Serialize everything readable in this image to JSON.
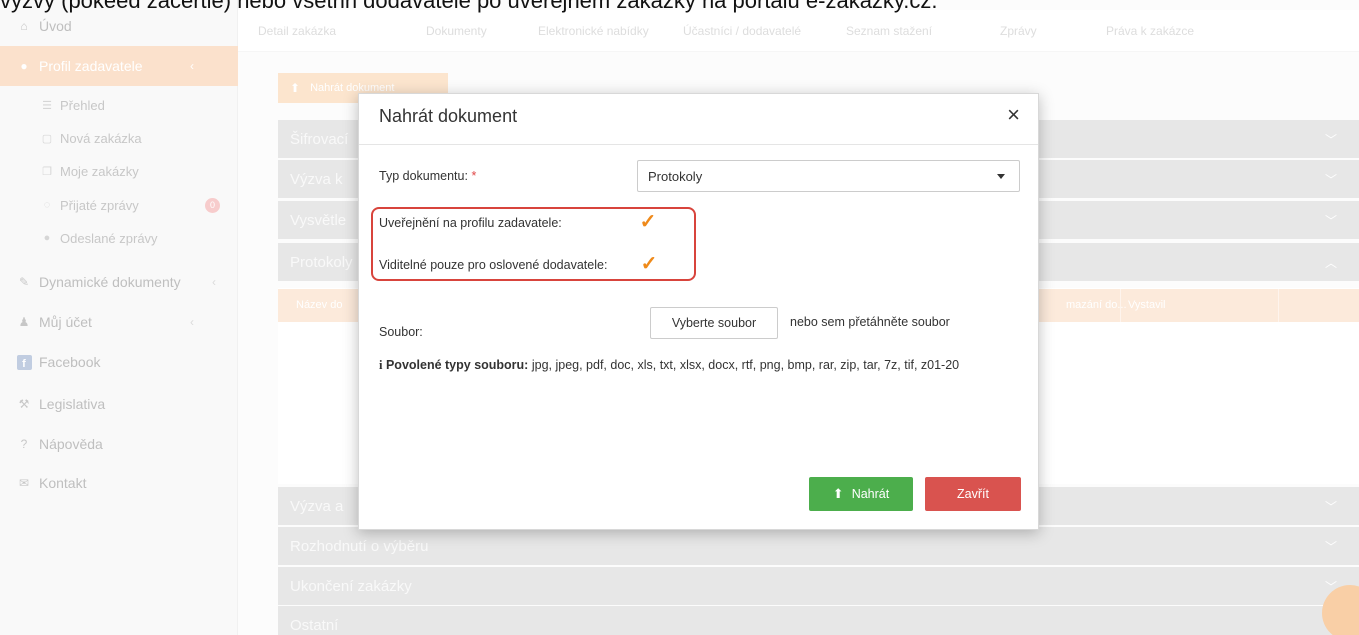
{
  "caption": "výzvy (pokeed zacertie) nebo všetnn dodavatele po uveřejnem zakázky na portalu e-zakazky.cz.",
  "sidebar": {
    "items": [
      {
        "label": "Úvod",
        "icon": "home-icon"
      },
      {
        "label": "Profil zadavatele",
        "icon": "profile-icon",
        "chevron": "‹"
      },
      {
        "label": "Dynamické dokumenty",
        "icon": "edit-icon",
        "chevron": "‹"
      },
      {
        "label": "Můj účet",
        "icon": "user-icon",
        "chevron": "‹"
      },
      {
        "label": "Facebook",
        "icon": "facebook-icon"
      },
      {
        "label": "Legislativa",
        "icon": "gavel-icon"
      },
      {
        "label": "Nápověda",
        "icon": "help-icon"
      },
      {
        "label": "Kontakt",
        "icon": "mail-icon"
      }
    ],
    "subitems": [
      {
        "label": "Přehled",
        "icon": "list-icon"
      },
      {
        "label": "Nová zakázka",
        "icon": "document-icon"
      },
      {
        "label": "Moje zakázky",
        "icon": "documents-icon"
      },
      {
        "label": "Přijaté zprávy",
        "icon": "chat-icon",
        "badge": "0"
      },
      {
        "label": "Odeslané zprávy",
        "icon": "chat-filled-icon"
      }
    ]
  },
  "tabs": [
    "Detail zakázka",
    "Dokumenty",
    "Elektronické nabídky",
    "Účastníci / dodavatelé",
    "Seznam stažení",
    "Zprávy",
    "Práva k zakázce"
  ],
  "upload_button": "Nahrát dokument",
  "accordion": [
    "Šifrovací",
    "Výzva k",
    "Vysvětle",
    "Protokoly",
    "Výzva a",
    "Rozhodnutí o výběru",
    "Ukončení zakázky",
    "Ostatní"
  ],
  "table_head": [
    "Název do",
    "mazání do...",
    "Vystavil"
  ],
  "modal": {
    "title": "Nahrát dokument",
    "close": "×",
    "doc_type_label": "Typ dokumentu:",
    "required_mark": "*",
    "doc_type_value": "Protokoly",
    "publish_label": "Uveřejnění na profilu zadavatele:",
    "visible_label": "Viditelné pouze pro oslovené dodavatele:",
    "publish_checked": true,
    "visible_checked": true,
    "checkmark": "✓",
    "file_label": "Soubor:",
    "file_button": "Vyberte soubor",
    "file_hint": "nebo sem přetáhněte soubor",
    "info_icon": "i",
    "allowed_label": "Povolené typy souboru:",
    "allowed_types": "jpg, jpeg, pdf, doc, xls, txt, xlsx, docx, rtf, png, bmp, rar, zip, tar, 7z, tif, z01-20",
    "upload_button": "Nahrát",
    "close_button": "Zavřít"
  },
  "colors": {
    "accent": "#f7c9a3",
    "check": "#ef8a1a",
    "highlight": "#d8443c",
    "green": "#4cae4c",
    "red": "#d9534f"
  }
}
